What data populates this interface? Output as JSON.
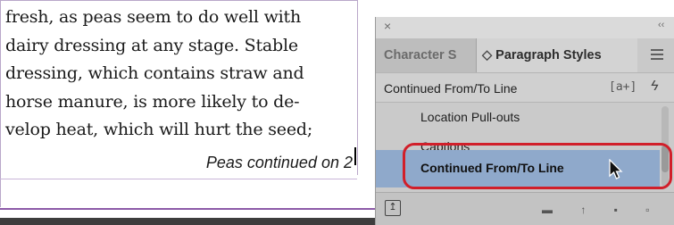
{
  "document": {
    "lines": [
      "fresh, as peas seem to do well with",
      "dairy dressing at any stage. Stable",
      "dressing, which contains straw and",
      "horse manure, is more likely to de-",
      "velop heat, which will hurt the seed;"
    ],
    "jump_line": "Peas continued on 2"
  },
  "panel": {
    "close_icon": "×",
    "collapse_icon": "‹‹",
    "tabs": [
      {
        "label": "Character S"
      },
      {
        "label": "Paragraph Styles",
        "arrows": "◇"
      }
    ],
    "current_style": "Continued From/To Line",
    "override_icon": "[a+]",
    "lightning_icon": "ϟ",
    "styles": [
      {
        "label": "Location Pull-outs"
      },
      {
        "label": "Captions"
      },
      {
        "label": "Continued From/To Line",
        "selected": true
      }
    ],
    "bottom_glyphs": "▬ ↑ ▪ ▫"
  },
  "colors": {
    "selection": "#8fa9cb",
    "highlight_ring": "#d11f2a",
    "frame_line": "#8c5aa8"
  }
}
